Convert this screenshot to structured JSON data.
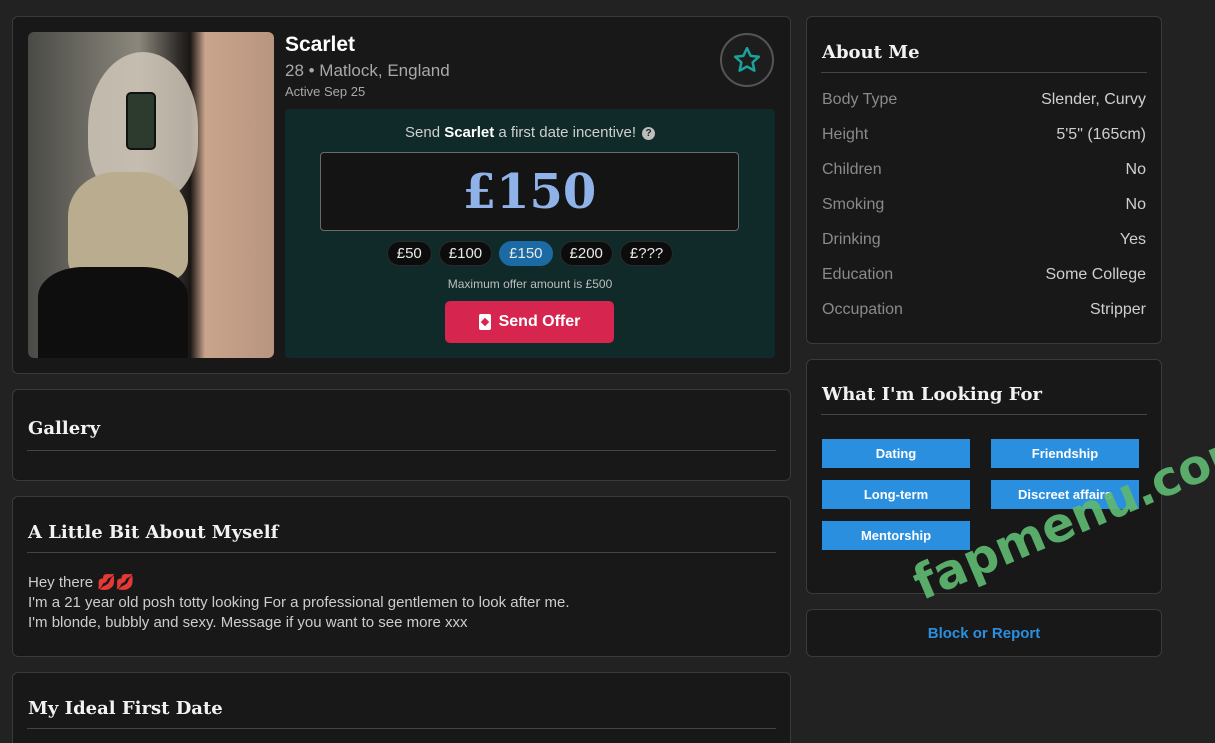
{
  "profile": {
    "name": "Scarlet",
    "age_location": "28 • Matlock, England",
    "active": "Active Sep 25"
  },
  "offer": {
    "prompt_prefix": "Send ",
    "prompt_name": "Scarlet",
    "prompt_suffix": " a first date incentive!",
    "help_glyph": "?",
    "amount": "£150",
    "chips": [
      "£50",
      "£100",
      "£150",
      "£200",
      "£???"
    ],
    "selected_chip": "£150",
    "max_note": "Maximum offer amount is £500",
    "send_label": "Send Offer"
  },
  "sections": {
    "gallery": "Gallery",
    "about_myself": "A Little Bit About Myself",
    "ideal_date": "My Ideal First Date"
  },
  "bio": {
    "line1": "Hey there 💋💋",
    "line2": "I'm a 21 year old posh totty looking For a professional gentlemen to look after me.",
    "line3": "I'm blonde, bubbly and sexy. Message if you want to see more xxx"
  },
  "about_me": {
    "title": "About Me",
    "rows": [
      {
        "k": "Body Type",
        "v": "Slender, Curvy"
      },
      {
        "k": "Height",
        "v": "5'5\" (165cm)"
      },
      {
        "k": "Children",
        "v": "No"
      },
      {
        "k": "Smoking",
        "v": "No"
      },
      {
        "k": "Drinking",
        "v": "Yes"
      },
      {
        "k": "Education",
        "v": "Some College"
      },
      {
        "k": "Occupation",
        "v": "Stripper"
      }
    ]
  },
  "looking_for": {
    "title": "What I'm Looking For",
    "tags": [
      "Dating",
      "Friendship",
      "Long-term",
      "Discreet affairs",
      "Mentorship"
    ]
  },
  "report_label": "Block or Report",
  "watermark": "fapmenu.com",
  "colors": {
    "background": "#222222",
    "card": "#181818",
    "offer_panel": "#0f2a29",
    "accent_blue": "#2b8fe0",
    "send_red": "#d6264f",
    "amount_blue": "#8fb3e8"
  }
}
